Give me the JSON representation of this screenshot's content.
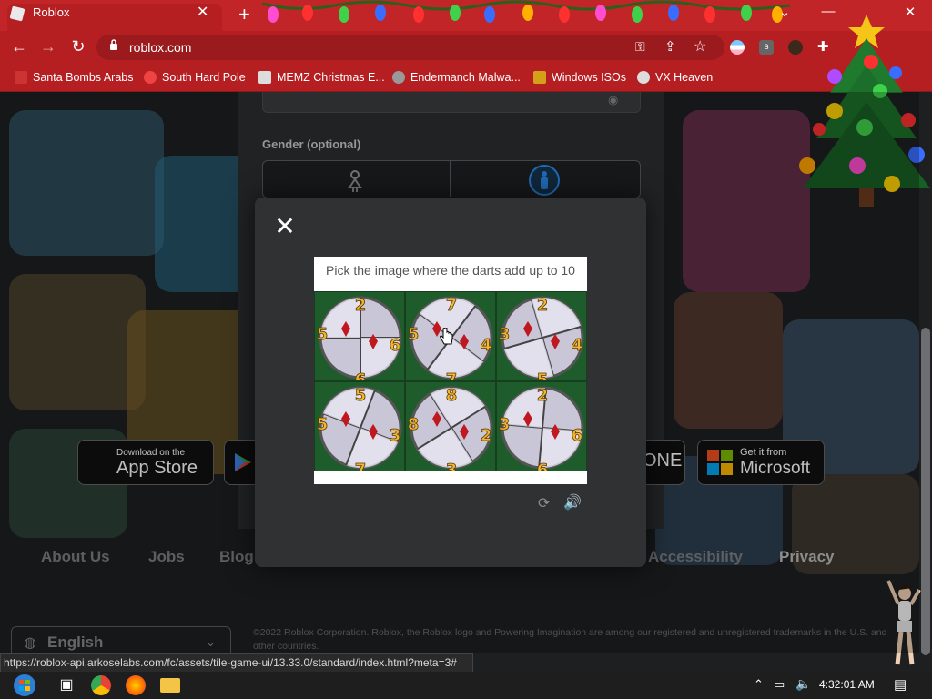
{
  "browser": {
    "tab_title": "Roblox",
    "new_tab_symbol": "+",
    "url": "roblox.com",
    "status_url": "https://roblox-api.arkoselabs.com/fc/assets/tile-game-ui/13.33.0/standard/index.html?meta=3#",
    "bookmarks": [
      {
        "label": "Santa Bombs Arabs",
        "icon": "santa-icon",
        "color": "#c33"
      },
      {
        "label": "South Hard Pole",
        "icon": "snowflake-icon",
        "color": "#e44"
      },
      {
        "label": "MEMZ Christmas E...",
        "icon": "image-icon",
        "color": "#ddd"
      },
      {
        "label": "Endermanch Malwa...",
        "icon": "raccoon-icon",
        "color": "#999"
      },
      {
        "label": "Windows ISOs",
        "icon": "trophy-icon",
        "color": "#d4a017"
      },
      {
        "label": "VX Heaven",
        "icon": "skull-icon",
        "color": "#ddd"
      }
    ]
  },
  "signup": {
    "gender_label": "Gender (optional)"
  },
  "stores": [
    {
      "top": "Download on the",
      "bottom": "App Store"
    },
    {
      "top": "",
      "bottom": "ONE"
    },
    {
      "top": "Get it from",
      "bottom": "Microsoft"
    }
  ],
  "footer": {
    "links": [
      "About Us",
      "Jobs",
      "Blog",
      "Accessibility",
      "Privacy"
    ],
    "language": "English",
    "copyright": "©2022 Roblox Corporation. Roblox, the Roblox logo and Powering Imagination are among our registered and unregistered trademarks in the U.S. and other countries."
  },
  "captcha": {
    "prompt": "Pick the image where the darts add up to 10",
    "close_symbol": "✕",
    "selected_index": 1,
    "tiles": [
      {
        "numbers": [
          "2",
          "6",
          "6",
          "5"
        ]
      },
      {
        "numbers": [
          "7",
          "4",
          "7",
          "5"
        ]
      },
      {
        "numbers": [
          "2",
          "4",
          "5",
          "3"
        ]
      },
      {
        "numbers": [
          "5",
          "3",
          "7",
          "5"
        ]
      },
      {
        "numbers": [
          "8",
          "2",
          "3",
          "8"
        ]
      },
      {
        "numbers": [
          "2",
          "6",
          "6",
          "3"
        ]
      }
    ]
  },
  "taskbar": {
    "clock": "4:32:01 AM"
  }
}
